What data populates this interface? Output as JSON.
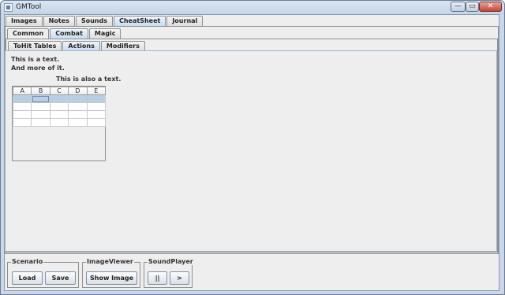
{
  "window": {
    "title": "GMTool",
    "min_label": "—",
    "max_label": "▭",
    "close_label": "✕"
  },
  "main_tabs": [
    "Images",
    "Notes",
    "Sounds",
    "CheatSheet",
    "Journal"
  ],
  "sub_tabs": [
    "Common",
    "Combat",
    "Magic"
  ],
  "combat_tabs": [
    "ToHit Tables",
    "Actions",
    "Modifiers"
  ],
  "content": {
    "line1": "This is a text.",
    "line2": "And more of it.",
    "line3": "This is also a text.",
    "table_headers": [
      "A",
      "B",
      "C",
      "D",
      "E"
    ]
  },
  "groups": {
    "scenario": {
      "title": "Scenario",
      "load": "Load",
      "save": "Save"
    },
    "image_viewer": {
      "title": "ImageViewer",
      "show": "Show Image"
    },
    "sound_player": {
      "title": "SoundPlayer",
      "pause": "||",
      "play": ">"
    }
  }
}
